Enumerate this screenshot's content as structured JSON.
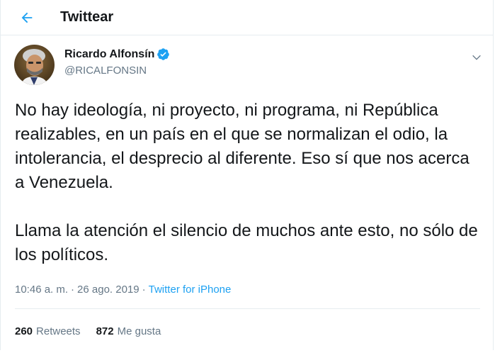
{
  "header": {
    "title": "Twittear",
    "back_icon": "arrow-left-icon"
  },
  "tweet": {
    "author": {
      "display_name": "Ricardo Alfonsín",
      "handle": "@RICALFONSIN",
      "verified": true,
      "verified_icon": "verified-badge-icon"
    },
    "menu_icon": "chevron-down-icon",
    "paragraphs": [
      "No hay ideología, ni proyecto, ni programa, ni República realizables, en un país en el que se normalizan el odio, la intolerancia, el desprecio al diferente. Eso sí que nos acerca a Venezuela.",
      "Llama la atención el silencio de muchos ante esto, no sólo de los políticos."
    ],
    "time": "10:46 a. m.",
    "separator": "·",
    "date": "26 ago. 2019",
    "source": "Twitter for iPhone",
    "stats": {
      "retweets_count": "260",
      "retweets_label": "Retweets",
      "likes_count": "872",
      "likes_label": "Me gusta"
    }
  },
  "colors": {
    "accent": "#1da1f2",
    "text_primary": "#14171a",
    "text_secondary": "#657786",
    "border": "#e6ecf0"
  }
}
